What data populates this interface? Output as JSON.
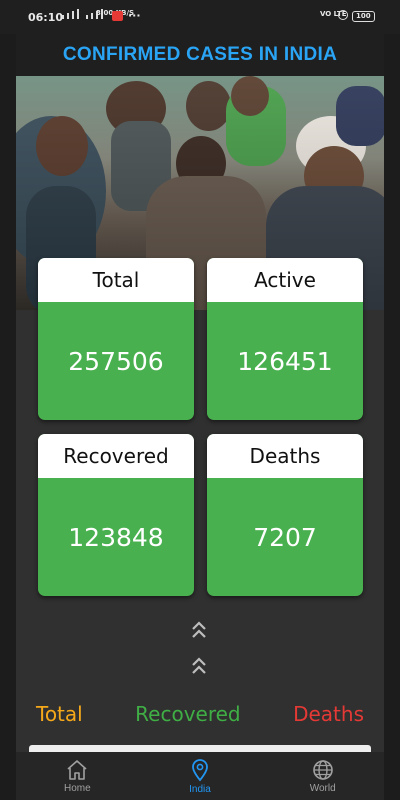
{
  "status_bar": {
    "time": "06:10",
    "network_speed": "3.00 KB/S",
    "more_indicator": "···",
    "volte": "VO LTE",
    "battery": "100"
  },
  "app": {
    "title": "CONFIRMED CASES IN INDIA",
    "title_color": "#2aa4f4",
    "card_color": "#49b04f"
  },
  "stats": [
    {
      "label": "Total",
      "value": "257506"
    },
    {
      "label": "Active",
      "value": "126451"
    },
    {
      "label": "Recovered",
      "value": "123848"
    },
    {
      "label": "Deaths",
      "value": "7207"
    }
  ],
  "scroll_hint_icon": "double-chevron-up-icon",
  "legend": [
    {
      "label": "Total",
      "color": "#f5a81a"
    },
    {
      "label": "Recovered",
      "color": "#3fae45"
    },
    {
      "label": "Deaths",
      "color": "#e53935"
    }
  ],
  "nav": {
    "items": [
      {
        "label": "Home",
        "icon": "home-icon"
      },
      {
        "label": "India",
        "icon": "location-pin-icon"
      },
      {
        "label": "World",
        "icon": "globe-icon"
      }
    ],
    "active": "India",
    "active_color": "#2196f3"
  }
}
